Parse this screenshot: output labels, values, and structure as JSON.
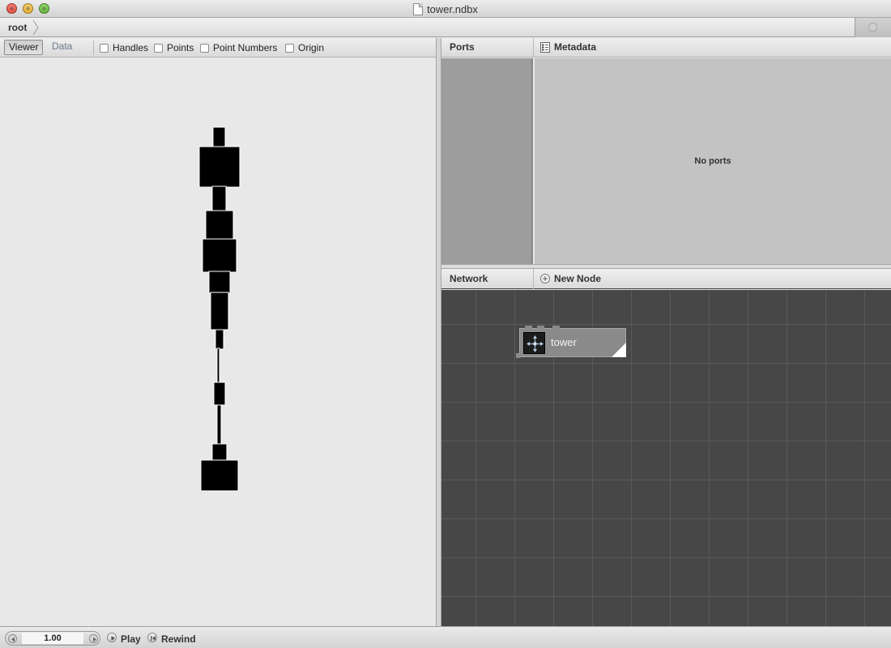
{
  "window": {
    "title": "tower.ndbx",
    "doc_icon": "document-icon"
  },
  "pathbar": {
    "crumb": "root"
  },
  "viewer": {
    "tabs": [
      {
        "label": "Viewer",
        "selected": true
      },
      {
        "label": "Data",
        "selected": false
      }
    ],
    "checkboxes": [
      {
        "label": "Handles",
        "checked": false
      },
      {
        "label": "Points",
        "checked": false
      },
      {
        "label": "Point Numbers",
        "checked": false
      },
      {
        "label": "Origin",
        "checked": false
      }
    ]
  },
  "ports": {
    "title": "Ports",
    "metadata_label": "Metadata",
    "empty_text": "No ports"
  },
  "network": {
    "title": "Network",
    "new_node_label": "New Node",
    "nodes": [
      {
        "name": "tower",
        "icon": "move-icon"
      }
    ]
  },
  "bottom": {
    "frame": "1.00",
    "play_label": "Play",
    "rewind_label": "Rewind"
  },
  "colors": {
    "shape_fill": "#000000",
    "network_bg": "#474747",
    "node_fill": "#8a8a8a"
  }
}
